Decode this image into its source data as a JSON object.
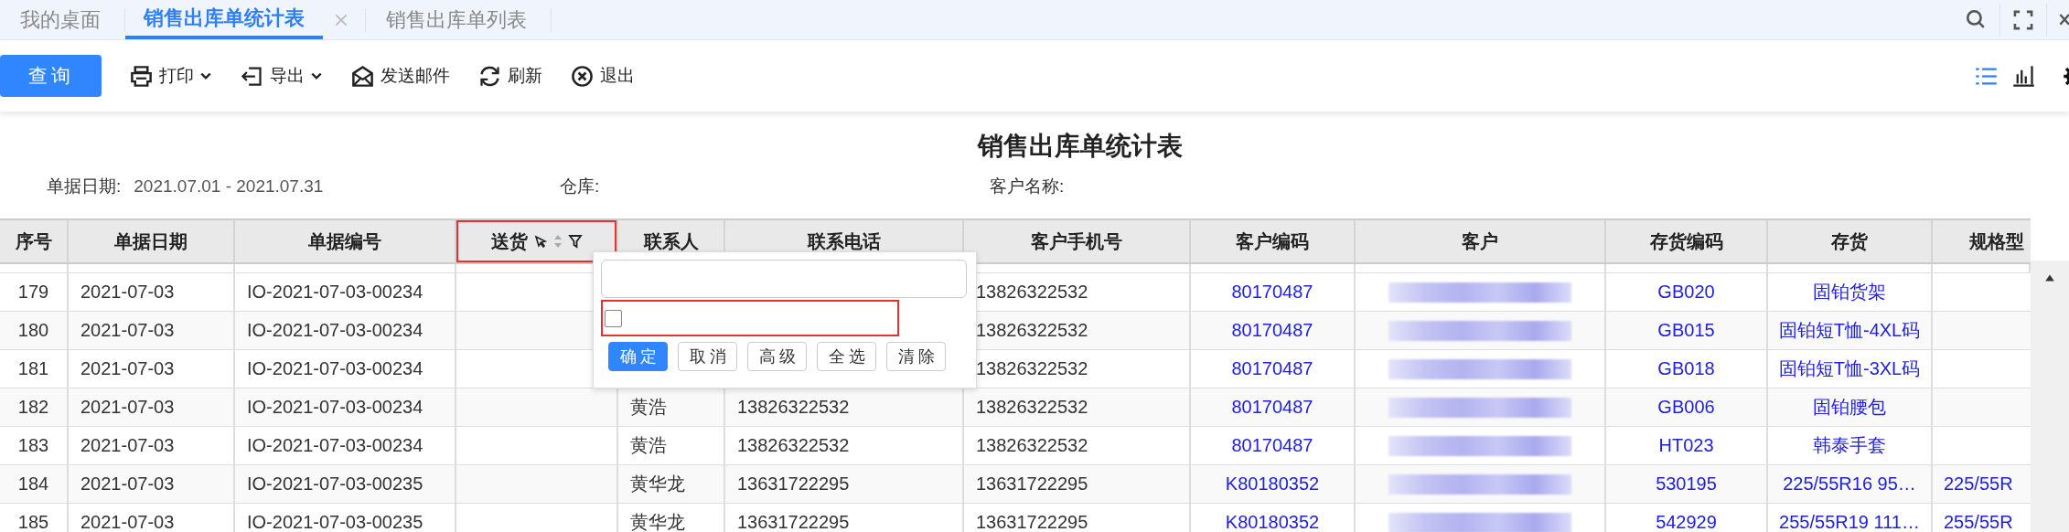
{
  "tabs": [
    {
      "label": "我的桌面",
      "selected": false,
      "closable": false
    },
    {
      "label": "销售出库单统计表",
      "selected": true,
      "closable": true
    },
    {
      "label": "销售出库单列表",
      "selected": false,
      "closable": false
    }
  ],
  "toolbar": {
    "query_button": "查询",
    "actions": [
      {
        "kind": "print",
        "label": "打印",
        "dropdown": true
      },
      {
        "kind": "export",
        "label": "导出",
        "dropdown": true
      },
      {
        "kind": "mail",
        "label": "发送邮件",
        "dropdown": false
      },
      {
        "kind": "refresh",
        "label": "刷新",
        "dropdown": false
      },
      {
        "kind": "exit",
        "label": "退出",
        "dropdown": false
      }
    ],
    "view_toggles": [
      {
        "kind": "list",
        "selected": true
      },
      {
        "kind": "chart",
        "selected": false
      }
    ]
  },
  "report": {
    "title": "销售出库单统计表",
    "filters": [
      {
        "label": "单据日期:",
        "value": "2021.07.01 - 2021.07.31"
      },
      {
        "label": "仓库:"
      },
      {
        "label": "客户名称:"
      }
    ]
  },
  "table": {
    "columns": [
      {
        "label": "序号",
        "kind": "center"
      },
      {
        "label": "单据日期",
        "kind": "text"
      },
      {
        "label": "单据编号",
        "kind": "text"
      },
      {
        "label": "送货",
        "kind": "text",
        "highlighted": true,
        "filter_open": true
      },
      {
        "label": "联系人",
        "kind": "text"
      },
      {
        "label": "联系电话",
        "kind": "text"
      },
      {
        "label": "客户手机号",
        "kind": "text"
      },
      {
        "label": "客户编码",
        "kind": "link"
      },
      {
        "label": "客户",
        "kind": "blurred"
      },
      {
        "label": "存货编码",
        "kind": "link"
      },
      {
        "label": "存货",
        "kind": "link"
      },
      {
        "label": "规格型",
        "kind": "link_left"
      }
    ],
    "rows": [
      [
        "179",
        "2021-07-03",
        "IO-2021-07-03-00234",
        null,
        null,
        null,
        "13826322532",
        "80170487",
        null,
        "GB020",
        "固铂货架",
        null
      ],
      [
        "180",
        "2021-07-03",
        "IO-2021-07-03-00234",
        null,
        null,
        null,
        "13826322532",
        "80170487",
        null,
        "GB015",
        "固铂短T恤-4XL码",
        null
      ],
      [
        "181",
        "2021-07-03",
        "IO-2021-07-03-00234",
        null,
        null,
        null,
        "13826322532",
        "80170487",
        null,
        "GB018",
        "固铂短T恤-3XL码",
        null
      ],
      [
        "182",
        "2021-07-03",
        "IO-2021-07-03-00234",
        null,
        "黄浩",
        "13826322532",
        "13826322532",
        "80170487",
        null,
        "GB006",
        "固铂腰包",
        null
      ],
      [
        "183",
        "2021-07-03",
        "IO-2021-07-03-00234",
        null,
        "黄浩",
        "13826322532",
        "13826322532",
        "80170487",
        null,
        "HT023",
        "韩泰手套",
        null
      ],
      [
        "184",
        "2021-07-03",
        "IO-2021-07-03-00235",
        null,
        "黄华龙",
        "13631722295",
        "13631722295",
        "K80180352",
        null,
        "530195",
        "225/55R16 95…",
        "225/55R"
      ],
      [
        "185",
        "2021-07-03",
        "IO-2021-07-03-00235",
        null,
        "黄华龙",
        "13631722295",
        "13631722295",
        "K80180352",
        null,
        "542929",
        "255/55R19 111…",
        "255/55R"
      ]
    ]
  },
  "filter_popup": {
    "checkbox_checked": false,
    "checkbox_highlighted": true,
    "buttons": [
      {
        "label": "确定",
        "primary": true
      },
      {
        "label": "取消",
        "primary": false
      },
      {
        "label": "高级",
        "primary": false
      },
      {
        "label": "全选",
        "primary": false
      },
      {
        "label": "清除",
        "primary": false
      }
    ]
  }
}
